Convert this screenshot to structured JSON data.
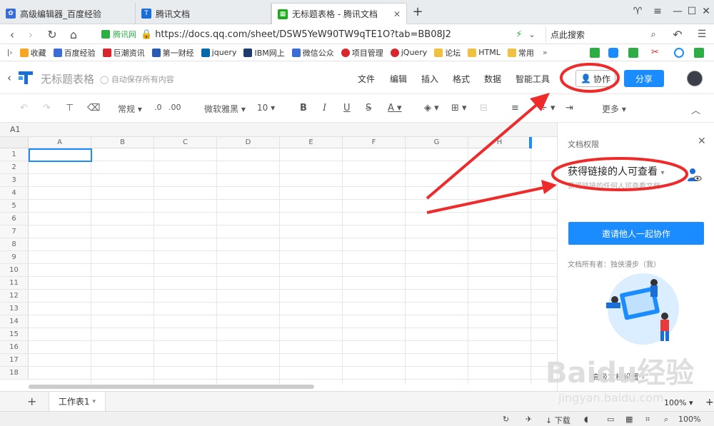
{
  "browser": {
    "tabs": [
      {
        "label": "高级编辑器_百度经验",
        "icon_color": "#3b6dd8"
      },
      {
        "label": "腾讯文档",
        "icon_color": "#1a6fd6"
      },
      {
        "label": "无标题表格 - 腾讯文档",
        "icon_color": "#1aad19"
      }
    ],
    "url_prefix": "腾讯网",
    "url": "https://docs.qq.com/sheet/DSW5YeW90TW9qTE1O?tab=BB08J2",
    "search_placeholder": "点此搜索",
    "bookmarks": [
      {
        "label": "收藏",
        "color": "#f5a623"
      },
      {
        "label": "百度经验",
        "color": "#3b6dd8"
      },
      {
        "label": "巨潮资讯",
        "color": "#d9262c"
      },
      {
        "label": "第一财经",
        "color": "#2a5ab8"
      },
      {
        "label": "jquery",
        "color": "#0769ad"
      },
      {
        "label": "IBM网上",
        "color": "#1f3a6e"
      },
      {
        "label": "微信公众",
        "color": "#3b6dd8"
      },
      {
        "label": "项目管理",
        "color": "#d9262c"
      },
      {
        "label": "jQuery",
        "color": "#d9262c"
      },
      {
        "label": "论坛",
        "color": "#f0c040"
      },
      {
        "label": "HTML",
        "color": "#f0c040"
      },
      {
        "label": "常用",
        "color": "#f0c040"
      }
    ]
  },
  "app": {
    "doc_title": "无标题表格",
    "autosave": "自动保存所有内容",
    "menu": [
      "文件",
      "编辑",
      "插入",
      "格式",
      "数据",
      "智能工具"
    ],
    "collab_label": "协作",
    "share_label": "分享"
  },
  "toolbar": {
    "number_format": "常规",
    "decimal_less": ".0",
    "decimal_more": ".00",
    "font": "微软雅黑",
    "font_size": "10",
    "more": "更多"
  },
  "sheet": {
    "cell_ref": "A1",
    "columns": [
      "A",
      "B",
      "C",
      "D",
      "E",
      "F",
      "G",
      "H"
    ],
    "rows": [
      "1",
      "2",
      "3",
      "4",
      "5",
      "6",
      "7",
      "8",
      "9",
      "10",
      "11",
      "12",
      "13",
      "14",
      "15",
      "16",
      "17",
      "18"
    ]
  },
  "panel": {
    "title": "文档权限",
    "permission": "获得链接的人可查看",
    "permission_desc": "获得链接的任何人可查看文档",
    "invite_label": "邀请他人一起协作",
    "owner": "文档所有者：独侠漫步（我）",
    "more_settings": "高级文档设置"
  },
  "sheet_tabs": {
    "tab1": "工作表1",
    "zoom": "100%"
  },
  "statusbar": {
    "download": "下载",
    "zoom": "100%"
  },
  "watermark": {
    "brand": "Baidu经验",
    "site": "jingyan.baidu.com"
  },
  "colors": {
    "accent": "#1a8cff",
    "annotation": "#ee2a2a"
  }
}
